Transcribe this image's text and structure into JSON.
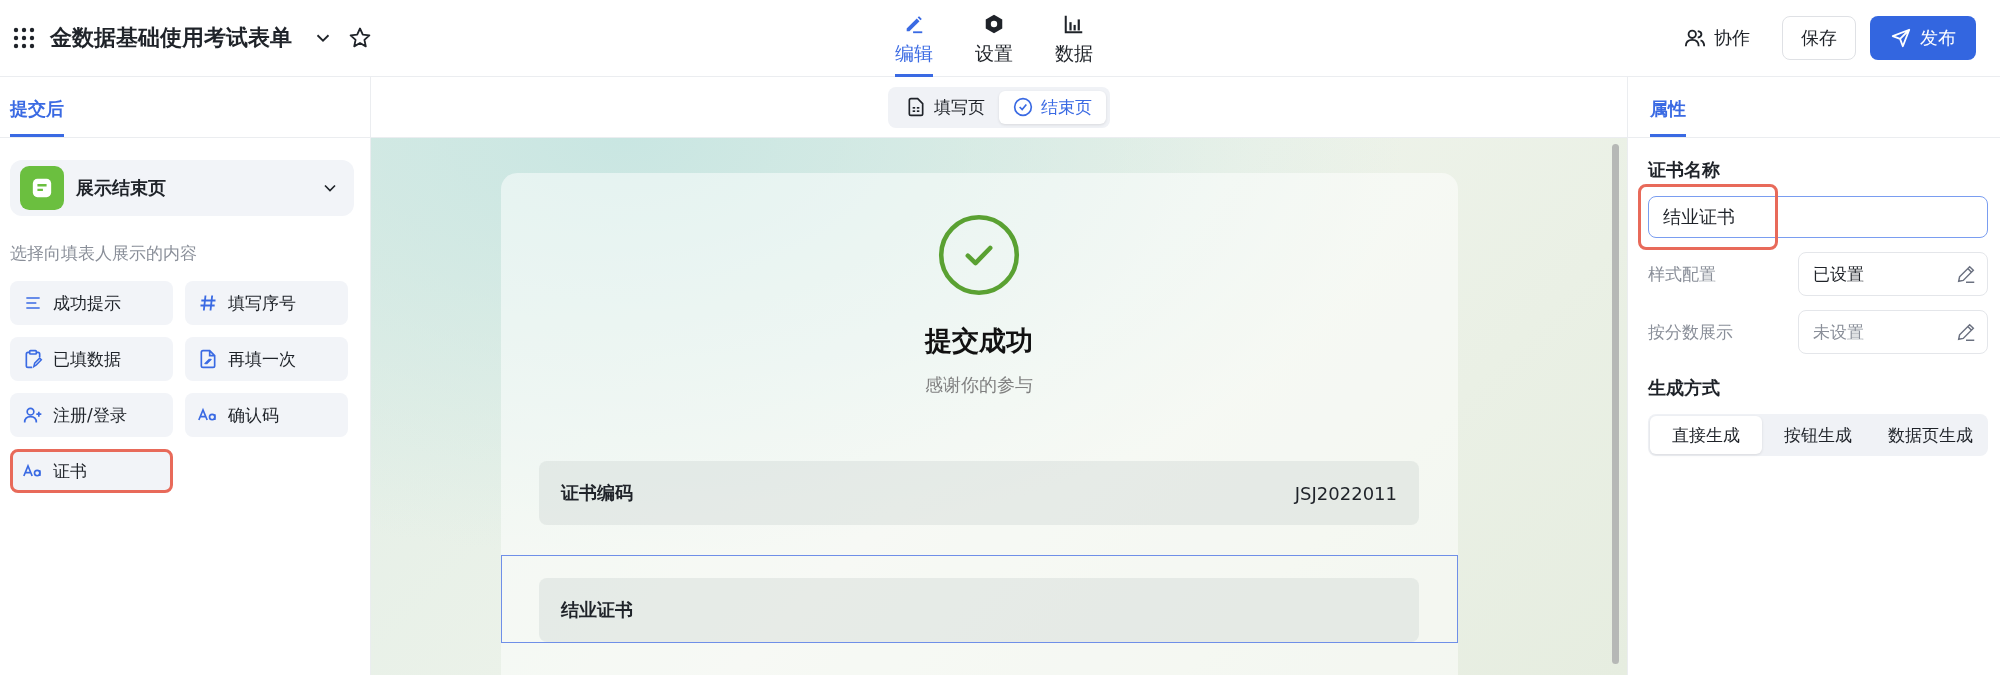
{
  "header": {
    "title": "金数据基础使用考试表单",
    "nav_tabs": [
      {
        "label": "编辑",
        "kind": "pencil",
        "selected": true
      },
      {
        "label": "设置",
        "kind": "hexagon",
        "selected": false
      },
      {
        "label": "数据",
        "kind": "bars",
        "selected": false
      }
    ],
    "actions": [
      {
        "label": "协作",
        "kind": "text"
      },
      {
        "label": "保存",
        "kind": "outline"
      },
      {
        "label": "发布",
        "kind": "primary"
      }
    ]
  },
  "left_panel": {
    "tab": {
      "label": "提交后",
      "selected": true
    },
    "dropdown": {
      "value": "展示结束页"
    },
    "section_label": "选择向填表人展示的内容",
    "items": [
      {
        "label": "成功提示",
        "kind": "lines",
        "highlighted": false
      },
      {
        "label": "填写序号",
        "kind": "hash",
        "highlighted": false
      },
      {
        "label": "已填数据",
        "kind": "clipboard",
        "highlighted": false
      },
      {
        "label": "再填一次",
        "kind": "file",
        "highlighted": false
      },
      {
        "label": "注册/登录",
        "kind": "user",
        "highlighted": false
      },
      {
        "label": "确认码",
        "kind": "text",
        "highlighted": false
      },
      {
        "label": "证书",
        "kind": "text",
        "highlighted": true
      }
    ]
  },
  "center": {
    "page_tabs": [
      {
        "label": "填写页",
        "kind": "form",
        "selected": false
      },
      {
        "label": "结束页",
        "kind": "check",
        "selected": true
      }
    ],
    "card": {
      "title": "提交成功",
      "subtitle": "感谢你的参与",
      "fields": [
        {
          "label": "证书编码",
          "value": "JSJ2022011",
          "selected": false
        },
        {
          "label": "结业证书",
          "selected": true
        }
      ]
    }
  },
  "right_panel": {
    "tab": {
      "label": "属性",
      "selected": true
    },
    "name_label": "证书名称",
    "name_field": {
      "value": "结业证书",
      "focused": true,
      "highlighted": true
    },
    "settings": [
      {
        "label": "样式配置",
        "value": "已设置",
        "set": true
      },
      {
        "label": "按分数展示",
        "value": "未设置",
        "set": false
      }
    ],
    "mode_label": "生成方式",
    "modes": [
      {
        "label": "直接生成",
        "selected": true
      },
      {
        "label": "按钮生成",
        "selected": false
      },
      {
        "label": "数据页生成",
        "selected": false
      }
    ]
  }
}
